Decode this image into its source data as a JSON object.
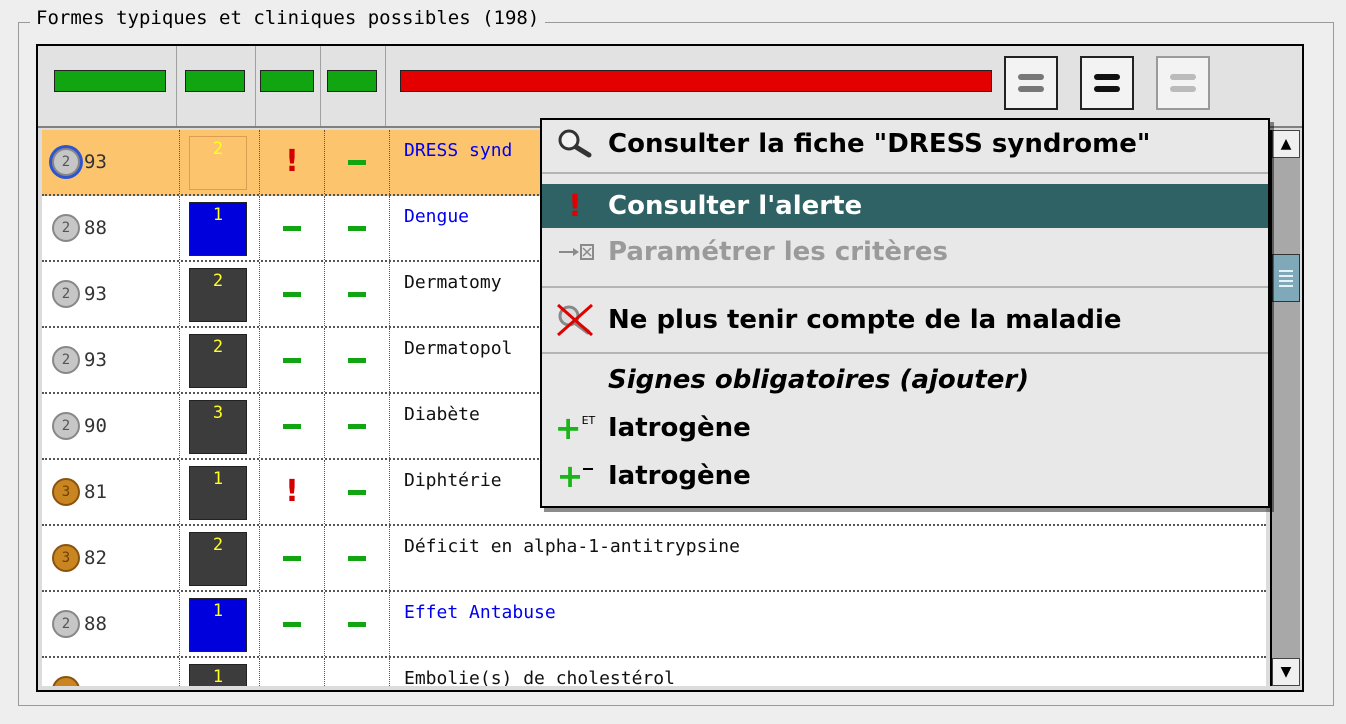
{
  "group_title": "Formes typiques et cliniques possibles (198)",
  "colors": {
    "header_green": "#11a511",
    "header_red": "#e20000",
    "selected_row": "#fdc46e",
    "menu_highlight": "#2e6265",
    "disease_link_blue": "#0000ee"
  },
  "view_buttons": [
    {
      "name": "list-view-icon",
      "state": "normal"
    },
    {
      "name": "list-view-bold-icon",
      "state": "normal"
    },
    {
      "name": "list-view-icon",
      "state": "disabled"
    }
  ],
  "rows": [
    {
      "coin": "2",
      "coin_color": "silver",
      "score": "93",
      "level": "2",
      "level_color": "orange",
      "alert": true,
      "dash": true,
      "name": "DRESS synd",
      "name_color": "blue",
      "selected": true
    },
    {
      "coin": "2",
      "coin_color": "silver",
      "score": "88",
      "level": "1",
      "level_color": "blue",
      "alert": false,
      "dash": true,
      "name": "Dengue",
      "name_color": "blue",
      "selected": false
    },
    {
      "coin": "2",
      "coin_color": "silver",
      "score": "93",
      "level": "2",
      "level_color": "dark",
      "alert": false,
      "dash": true,
      "name": "Dermatomy",
      "name_color": "black",
      "selected": false
    },
    {
      "coin": "2",
      "coin_color": "silver",
      "score": "93",
      "level": "2",
      "level_color": "dark",
      "alert": false,
      "dash": true,
      "name": "Dermatopol",
      "name_color": "black",
      "selected": false
    },
    {
      "coin": "2",
      "coin_color": "silver",
      "score": "90",
      "level": "3",
      "level_color": "dark",
      "alert": false,
      "dash": true,
      "name": "Diabète",
      "name_color": "black",
      "selected": false
    },
    {
      "coin": "3",
      "coin_color": "gold",
      "score": "81",
      "level": "1",
      "level_color": "dark",
      "alert": true,
      "dash": true,
      "name": "Diphtérie",
      "name_color": "black",
      "selected": false
    },
    {
      "coin": "3",
      "coin_color": "gold",
      "score": "82",
      "level": "2",
      "level_color": "dark",
      "alert": false,
      "dash": true,
      "name": "Déficit en alpha-1-antitrypsine",
      "name_color": "black",
      "selected": false
    },
    {
      "coin": "2",
      "coin_color": "silver",
      "score": "88",
      "level": "1",
      "level_color": "blue",
      "alert": false,
      "dash": true,
      "name": "Effet Antabuse",
      "name_color": "blue",
      "selected": false
    },
    {
      "coin": "",
      "coin_color": "gold",
      "score": "",
      "level": "1",
      "level_color": "dark",
      "alert": false,
      "dash": false,
      "name": "Embolie(s) de cholestérol",
      "name_color": "black",
      "selected": false
    }
  ],
  "context_menu": {
    "items": [
      {
        "icon": "magnifier-icon",
        "label": "Consulter la fiche \"DRESS syndrome\"",
        "state": "normal"
      },
      {
        "icon": "alert-icon",
        "label": "Consulter l'alerte",
        "state": "highlighted"
      },
      {
        "icon": "criteria-settings-icon",
        "label": "Paramétrer les critères",
        "state": "disabled"
      },
      {
        "icon": "crossed-magnifier-icon",
        "label": "Ne plus tenir compte de la maladie",
        "state": "normal"
      },
      {
        "icon": "",
        "label": "Signes obligatoires (ajouter)",
        "state": "heading"
      },
      {
        "icon": "add-and-icon",
        "label": "Iatrogène",
        "state": "normal"
      },
      {
        "icon": "add-minus-icon",
        "label": "Iatrogène",
        "state": "normal"
      }
    ],
    "icon_text": {
      "and_sup": "ET"
    }
  }
}
